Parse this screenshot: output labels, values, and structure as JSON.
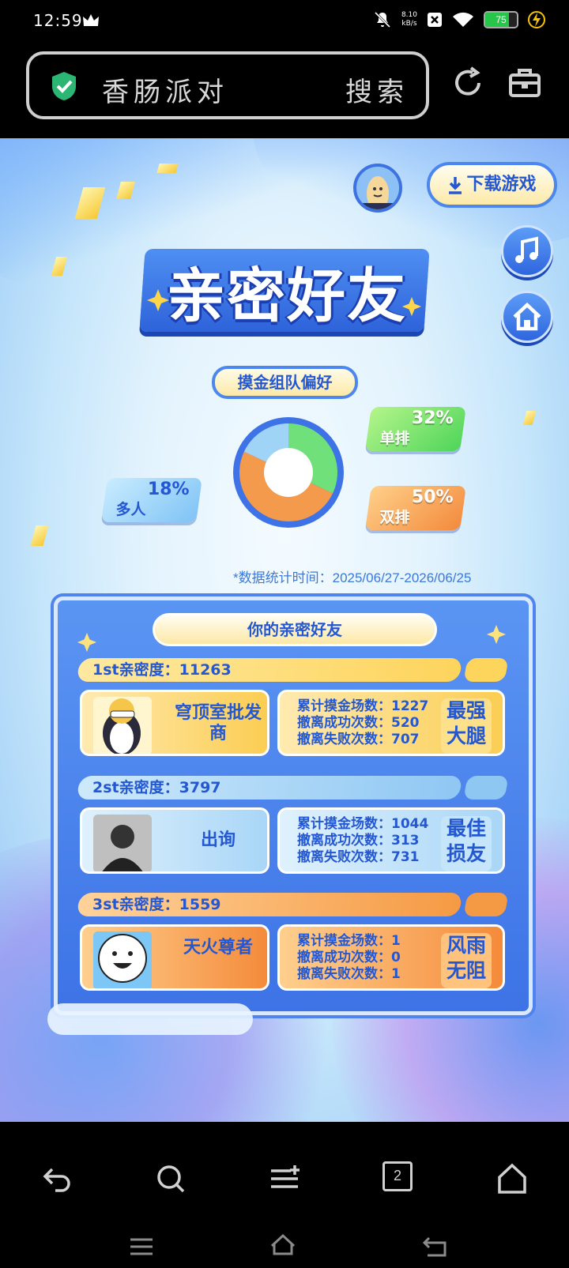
{
  "status_bar": {
    "time": "12:59",
    "net_speed_value": "8.10",
    "net_speed_unit": "kB/s",
    "battery": "75",
    "battery_level": 0.75
  },
  "browser": {
    "search_query": "香肠派对",
    "search_button": "搜索"
  },
  "game": {
    "download_button": "下载游戏",
    "title": "亲密好友",
    "subtitle": "摸金组队偏好",
    "preferences": [
      {
        "label": "单排",
        "percent": "32%",
        "value": 32,
        "color": "#6fe07a"
      },
      {
        "label": "双排",
        "percent": "50%",
        "value": 50,
        "color": "#f39a4c"
      },
      {
        "label": "多人",
        "percent": "18%",
        "value": 18,
        "color": "#9fd4f6"
      }
    ],
    "stats_note": "*数据统计时间：2025/06/27-2026/06/25",
    "panel_title": "你的亲密好友",
    "friends": [
      {
        "rank_label": "1st亲密度：",
        "intimacy": "11263",
        "name": "穹顶室批发商",
        "stats": [
          "累计摸金场数：1227",
          "撤离成功次数：520",
          "撤离失败次数：707"
        ],
        "title": "最强大腿"
      },
      {
        "rank_label": "2st亲密度：",
        "intimacy": "3797",
        "name": "出询",
        "stats": [
          "累计摸金场数：1044",
          "撤离成功次数：313",
          "撤离失败次数：731"
        ],
        "title": "最佳损友"
      },
      {
        "rank_label": "3st亲密度：",
        "intimacy": "1559",
        "name": "天火尊者",
        "stats": [
          "累计摸金场数：1",
          "撤离成功次数：0",
          "撤离失败次数：1"
        ],
        "title": "风雨无阻"
      }
    ]
  },
  "bottom_nav": {
    "tab_count": "2"
  },
  "icons": [
    "crown-icon",
    "mute-icon",
    "close-box-icon",
    "wifi-icon",
    "battery-icon",
    "charging-icon",
    "shield-check-icon",
    "refresh-icon",
    "toolbox-icon",
    "download-icon",
    "music-icon",
    "home-icon",
    "back-icon",
    "search-icon",
    "menu-icon",
    "tabs-icon",
    "home-nav-icon"
  ]
}
